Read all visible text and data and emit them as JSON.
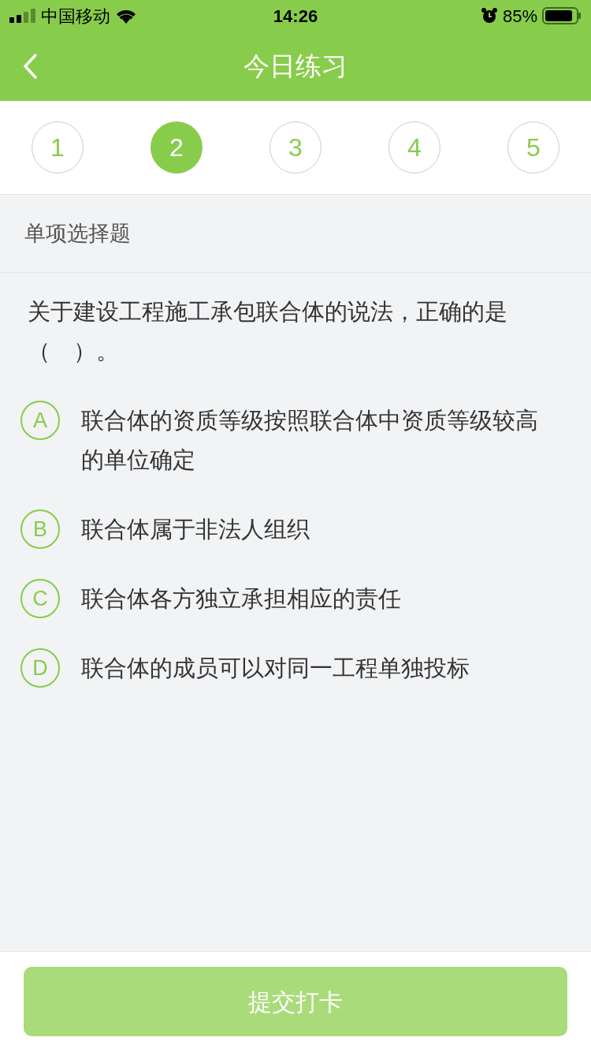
{
  "status_bar": {
    "carrier": "中国移动",
    "time": "14:26",
    "battery": "85%"
  },
  "nav": {
    "title": "今日练习"
  },
  "steps": [
    {
      "label": "1",
      "selected": false
    },
    {
      "label": "2",
      "selected": true
    },
    {
      "label": "3",
      "selected": false
    },
    {
      "label": "4",
      "selected": false
    },
    {
      "label": "5",
      "selected": false
    }
  ],
  "section_label": "单项选择题",
  "question": "关于建设工程施工承包联合体的说法，正确的是（　）。",
  "options": [
    {
      "letter": "A",
      "text": "联合体的资质等级按照联合体中资质等级较高的单位确定",
      "selected": false
    },
    {
      "letter": "B",
      "text": "联合体属于非法人组织",
      "selected": false
    },
    {
      "letter": "C",
      "text": "联合体各方独立承担相应的责任",
      "selected": false
    },
    {
      "letter": "D",
      "text": "联合体的成员可以对同一工程单独投标",
      "selected": false
    }
  ],
  "submit": {
    "label": "提交打卡",
    "disabled": true
  }
}
